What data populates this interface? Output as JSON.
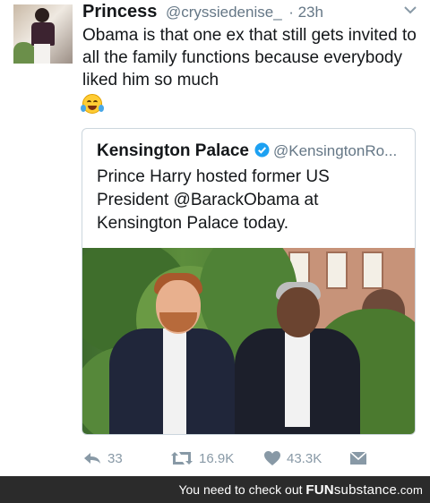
{
  "tweet": {
    "author_name": "Princess",
    "author_handle": "@cryssiedenise_",
    "time": "· 23h",
    "text": "Obama is that one ex that still gets invited to all the family functions because everybody liked him so much",
    "emoji_icon": "face-with-tears-of-joy",
    "quoted": {
      "author_name": "Kensington Palace",
      "author_handle": "@KensingtonRo...",
      "verified": true,
      "text": "Prince Harry hosted former US President @BarackObama at Kensington Palace today."
    },
    "actions": {
      "reply_count": "33",
      "retweet_count": "16.9K",
      "like_count": "43.3K"
    }
  },
  "footer": {
    "text": "You need to check out",
    "brand_a": "FUN",
    "brand_b": "substance",
    "brand_tld": ".com"
  },
  "colors": {
    "text": "#14171a",
    "secondary": "#657786",
    "verified": "#1da1f2",
    "footer_bg": "#2b2b2b"
  }
}
